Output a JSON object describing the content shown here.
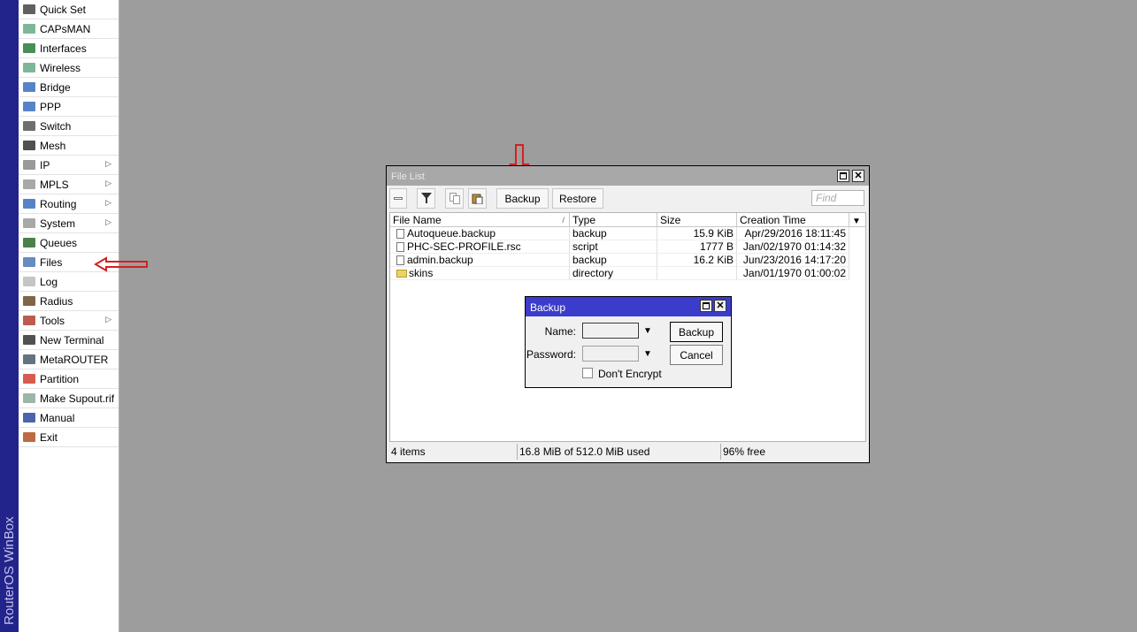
{
  "brand": {
    "text": "RouterOS WinBox"
  },
  "sidebar": {
    "items": [
      {
        "label": "Quick Set",
        "icon": "quick-set-icon",
        "submenu": false
      },
      {
        "label": "CAPsMAN",
        "icon": "capsman-icon",
        "submenu": false
      },
      {
        "label": "Interfaces",
        "icon": "interfaces-icon",
        "submenu": false
      },
      {
        "label": "Wireless",
        "icon": "wireless-icon",
        "submenu": false
      },
      {
        "label": "Bridge",
        "icon": "bridge-icon",
        "submenu": false
      },
      {
        "label": "PPP",
        "icon": "ppp-icon",
        "submenu": false
      },
      {
        "label": "Switch",
        "icon": "switch-icon",
        "submenu": false
      },
      {
        "label": "Mesh",
        "icon": "mesh-icon",
        "submenu": false
      },
      {
        "label": "IP",
        "icon": "ip-icon",
        "submenu": true
      },
      {
        "label": "MPLS",
        "icon": "mpls-icon",
        "submenu": true
      },
      {
        "label": "Routing",
        "icon": "routing-icon",
        "submenu": true
      },
      {
        "label": "System",
        "icon": "system-icon",
        "submenu": true
      },
      {
        "label": "Queues",
        "icon": "queues-icon",
        "submenu": false
      },
      {
        "label": "Files",
        "icon": "files-icon",
        "submenu": false
      },
      {
        "label": "Log",
        "icon": "log-icon",
        "submenu": false
      },
      {
        "label": "Radius",
        "icon": "radius-icon",
        "submenu": false
      },
      {
        "label": "Tools",
        "icon": "tools-icon",
        "submenu": true
      },
      {
        "label": "New Terminal",
        "icon": "terminal-icon",
        "submenu": false
      },
      {
        "label": "MetaROUTER",
        "icon": "metarouter-icon",
        "submenu": false
      },
      {
        "label": "Partition",
        "icon": "partition-icon",
        "submenu": false
      },
      {
        "label": "Make Supout.rif",
        "icon": "supout-icon",
        "submenu": false
      },
      {
        "label": "Manual",
        "icon": "manual-icon",
        "submenu": false
      },
      {
        "label": "Exit",
        "icon": "exit-icon",
        "submenu": false
      }
    ]
  },
  "file_window": {
    "title": "File List",
    "toolbar": {
      "backup_label": "Backup",
      "restore_label": "Restore",
      "find_placeholder": "Find"
    },
    "columns": [
      "File Name",
      "Type",
      "Size",
      "Creation Time"
    ],
    "rows": [
      {
        "name": "Autoqueue.backup",
        "type": "backup",
        "size": "15.9 KiB",
        "created": "Apr/29/2016 18:11:45",
        "kind": "file"
      },
      {
        "name": "PHC-SEC-PROFILE.rsc",
        "type": "script",
        "size": "1777 B",
        "created": "Jan/02/1970 01:14:32",
        "kind": "file"
      },
      {
        "name": "admin.backup",
        "type": "backup",
        "size": "16.2 KiB",
        "created": "Jun/23/2016 14:17:20",
        "kind": "file"
      },
      {
        "name": "skins",
        "type": "directory",
        "size": "",
        "created": "Jan/01/1970 01:00:02",
        "kind": "folder"
      }
    ],
    "status": {
      "count": "4 items",
      "usage": "16.8 MiB of 512.0 MiB used",
      "free": "96% free"
    }
  },
  "backup_dialog": {
    "title": "Backup",
    "name_label": "Name:",
    "password_label": "Password:",
    "name_value": "",
    "password_value": "",
    "backup_button": "Backup",
    "cancel_button": "Cancel",
    "dont_encrypt_label": "Don't Encrypt",
    "dont_encrypt_checked": false
  },
  "colors": {
    "brand_strip": "#23238c",
    "dialog_title": "#3c3ccc",
    "annotation_arrow": "#d42020",
    "desktop": "#9d9d9d"
  }
}
